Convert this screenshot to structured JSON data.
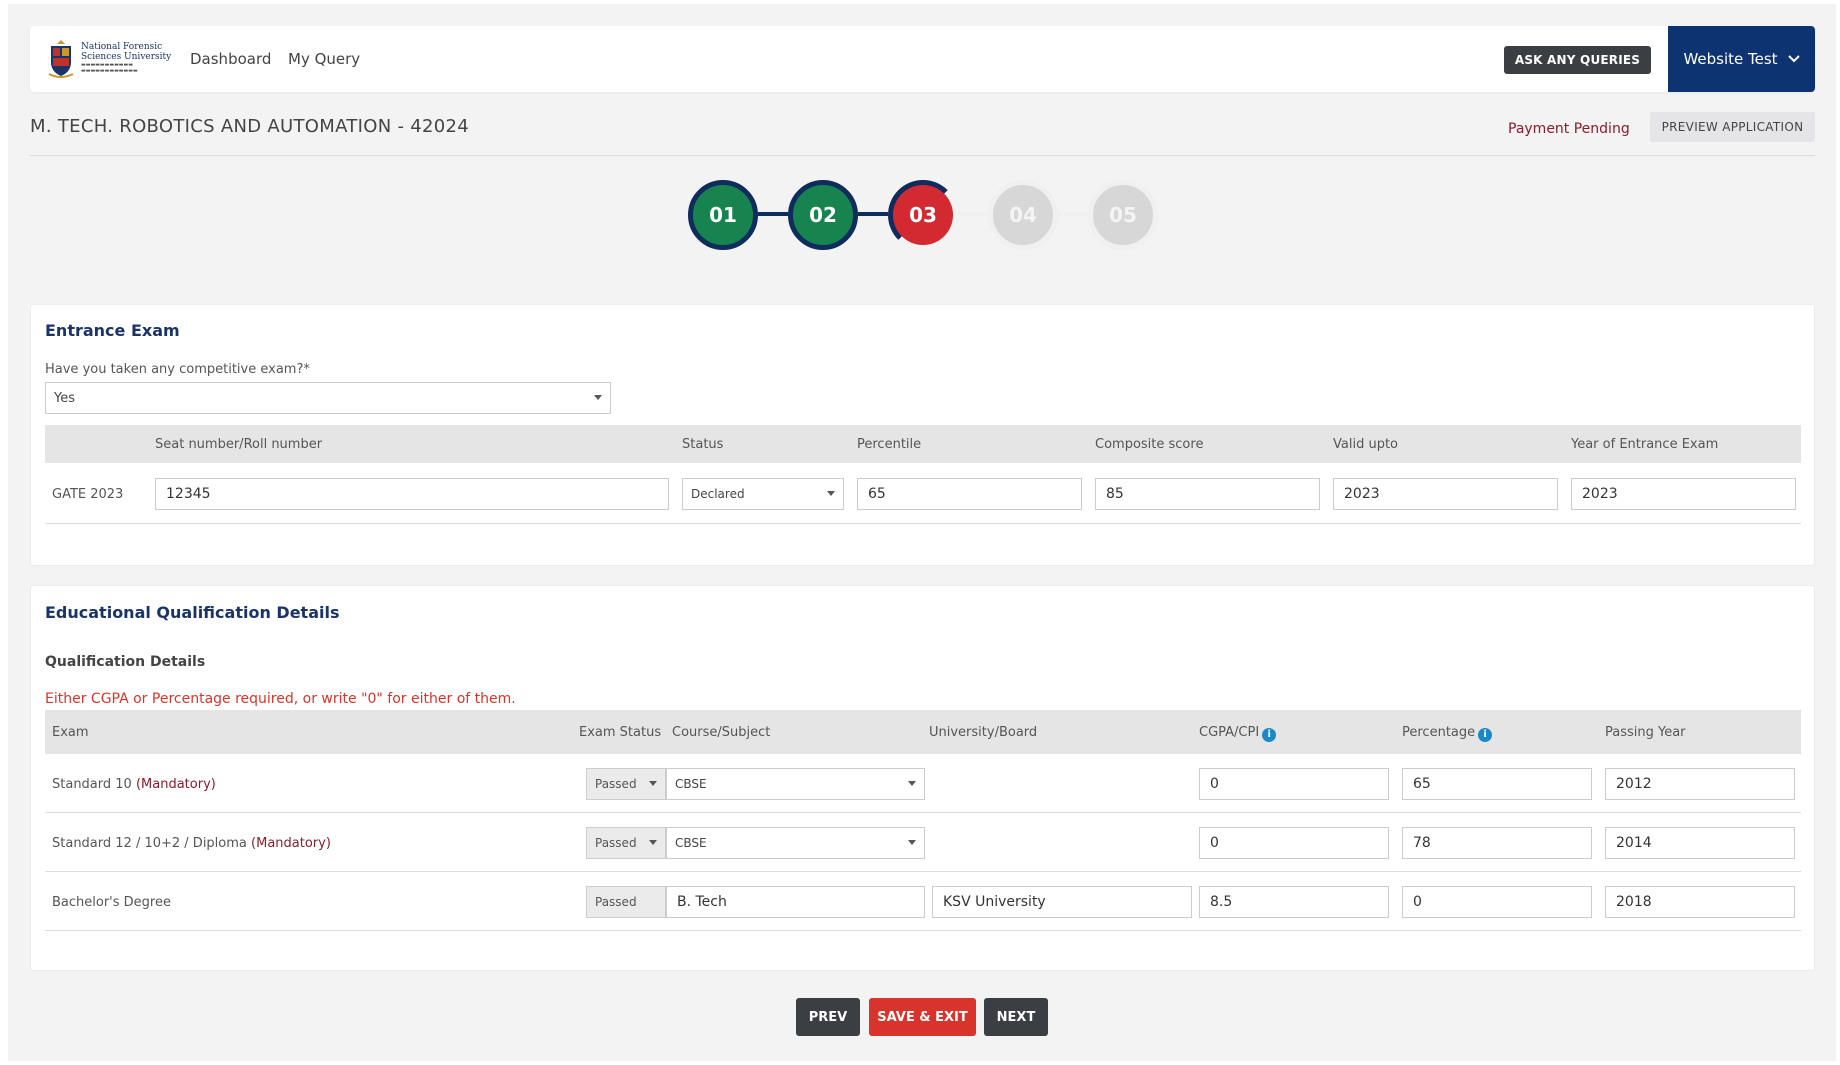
{
  "header": {
    "logo": {
      "name": "National Forensic Sciences University",
      "line1": "National Forensic",
      "line2": "Sciences University"
    },
    "nav": [
      {
        "label": "Dashboard"
      },
      {
        "label": "My Query"
      }
    ],
    "ask_button": "ASK ANY QUERIES",
    "user_menu": {
      "label": "Website Test",
      "icon": "chevron-down-icon"
    }
  },
  "page": {
    "title": "M. TECH. ROBOTICS AND AUTOMATION - 42024",
    "payment_status": "Payment Pending",
    "preview_button": "PREVIEW APPLICATION"
  },
  "stepper": {
    "steps": [
      {
        "label": "01",
        "state": "completed"
      },
      {
        "label": "02",
        "state": "completed"
      },
      {
        "label": "03",
        "state": "active"
      },
      {
        "label": "04",
        "state": "pending"
      },
      {
        "label": "05",
        "state": "pending"
      }
    ]
  },
  "entrance_exam": {
    "title": "Entrance Exam",
    "question": "Have you taken any competitive exam?*",
    "answer": "Yes",
    "columns": [
      "Seat number/Roll number",
      "Status",
      "Percentile",
      "Composite score",
      "Valid upto",
      "Year of Entrance Exam"
    ],
    "row": {
      "exam": "GATE 2023",
      "seat_number": "12345",
      "status": "Declared",
      "percentile": "65",
      "composite_score": "85",
      "valid_upto": "2023",
      "year": "2023"
    }
  },
  "education": {
    "title": "Educational Qualification Details",
    "subtitle": "Qualification Details",
    "note": "Either CGPA or Percentage required, or write \"0\" for either of them.",
    "columns": [
      "Exam",
      "Exam Status",
      "Course/Subject",
      "University/Board",
      "CGPA/CPI",
      "Percentage",
      "Passing Year"
    ],
    "rows": [
      {
        "exam": "Standard 10",
        "mandatory": "(Mandatory)",
        "status": "Passed",
        "course": "CBSE",
        "university": "",
        "cgpa": "0",
        "percentage": "65",
        "year": "2012"
      },
      {
        "exam": "Standard 12 / 10+2 / Diploma",
        "mandatory": "(Mandatory)",
        "status": "Passed",
        "course": "CBSE",
        "university": "",
        "cgpa": "0",
        "percentage": "78",
        "year": "2014"
      },
      {
        "exam": "Bachelor's Degree",
        "mandatory": "",
        "status": "Passed",
        "course": "B. Tech",
        "university": "KSV University",
        "cgpa": "8.5",
        "percentage": "0",
        "year": "2018"
      }
    ]
  },
  "actions": {
    "prev": "PREV",
    "save_exit": "SAVE & EXIT",
    "next": "NEXT"
  },
  "colors": {
    "navy": "#0d3470",
    "green": "#17834e",
    "red": "#d32a32",
    "dark_button": "#3b3f44",
    "warning": "#d9342b"
  }
}
